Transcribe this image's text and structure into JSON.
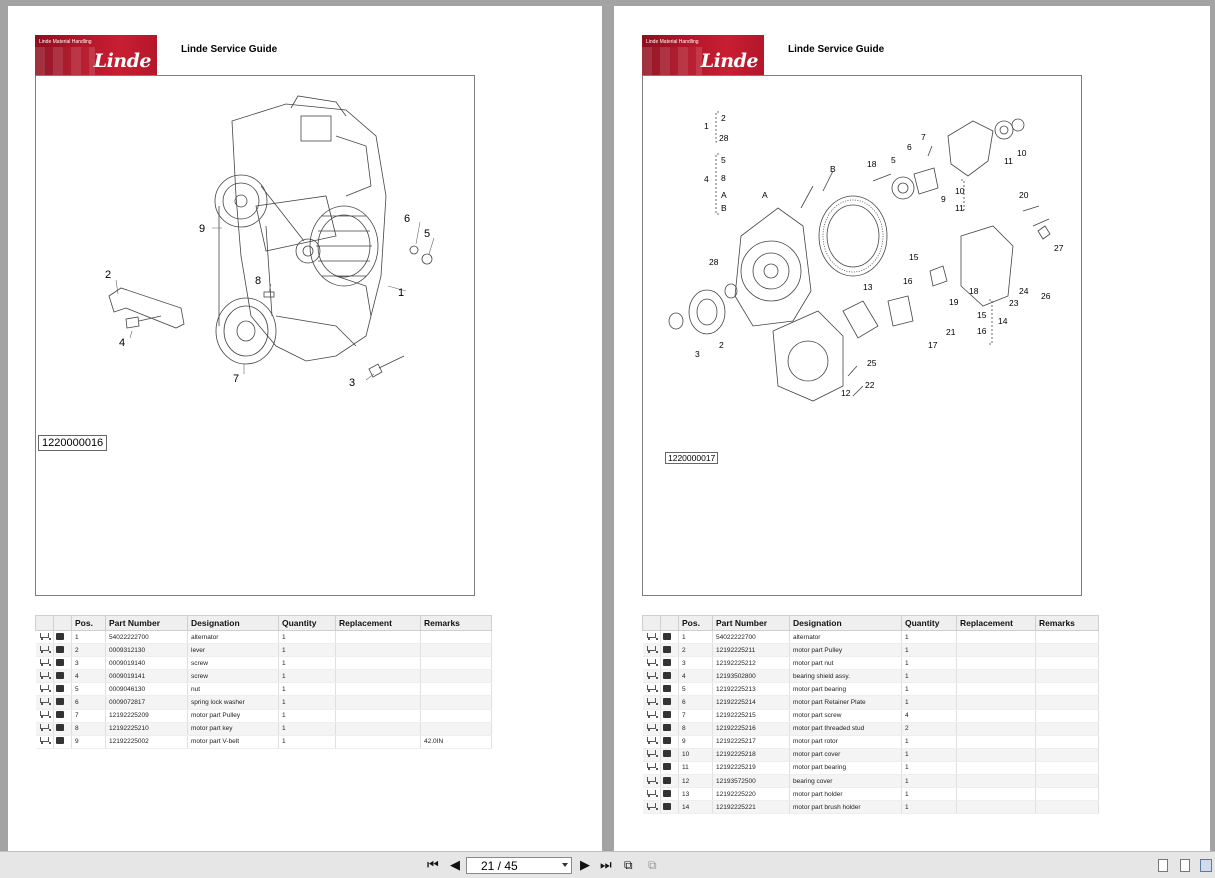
{
  "left_page": {
    "logo": {
      "small_text": "Linde Material Handling",
      "brand": "Linde"
    },
    "guide_title": "Linde Service Guide",
    "figure_id": "1220000016",
    "callouts": [
      "1",
      "2",
      "3",
      "4",
      "5",
      "6",
      "7",
      "8",
      "9"
    ],
    "table": {
      "headers": [
        "Pos.",
        "Part Number",
        "Designation",
        "Quantity",
        "Replacement",
        "Remarks"
      ],
      "rows": [
        [
          "1",
          "54022222700",
          "alternator",
          "1",
          "",
          ""
        ],
        [
          "2",
          "0009312130",
          "lever",
          "1",
          "",
          ""
        ],
        [
          "3",
          "0009019140",
          "screw",
          "1",
          "",
          ""
        ],
        [
          "4",
          "0009019141",
          "screw",
          "1",
          "",
          ""
        ],
        [
          "5",
          "0009046130",
          "nut",
          "1",
          "",
          ""
        ],
        [
          "6",
          "0009072817",
          "spring lock washer",
          "1",
          "",
          ""
        ],
        [
          "7",
          "12192225209",
          "motor part Pulley",
          "1",
          "",
          ""
        ],
        [
          "8",
          "12192225210",
          "motor part key",
          "1",
          "",
          ""
        ],
        [
          "9",
          "12192225002",
          "motor part V-belt",
          "1",
          "",
          "42.0IN"
        ]
      ]
    }
  },
  "right_page": {
    "logo": {
      "small_text": "Linde Material Handling",
      "brand": "Linde"
    },
    "guide_title": "Linde Service Guide",
    "figure_id": "1220000017",
    "callouts": [
      "1",
      "2",
      "28",
      "4",
      "5",
      "8",
      "A",
      "B",
      "A",
      "B",
      "18",
      "7",
      "6",
      "5",
      "10",
      "11",
      "9",
      "10",
      "11",
      "20",
      "27",
      "15",
      "16",
      "18",
      "19",
      "15",
      "14",
      "16",
      "13",
      "21",
      "17",
      "25",
      "22",
      "12",
      "24",
      "26",
      "23",
      "28",
      "3",
      "2"
    ],
    "table": {
      "headers": [
        "Pos.",
        "Part Number",
        "Designation",
        "Quantity",
        "Replacement",
        "Remarks"
      ],
      "rows": [
        [
          "1",
          "54022222700",
          "alternator",
          "1",
          "",
          ""
        ],
        [
          "2",
          "12192225211",
          "motor part Pulley",
          "1",
          "",
          ""
        ],
        [
          "3",
          "12192225212",
          "motor part nut",
          "1",
          "",
          ""
        ],
        [
          "4",
          "12193502800",
          "bearing shield assy.",
          "1",
          "",
          ""
        ],
        [
          "5",
          "12192225213",
          "motor part bearing",
          "1",
          "",
          ""
        ],
        [
          "6",
          "12192225214",
          "motor part Retainer Plate",
          "1",
          "",
          ""
        ],
        [
          "7",
          "12192225215",
          "motor part screw",
          "4",
          "",
          ""
        ],
        [
          "8",
          "12192225216",
          "motor part threaded stud",
          "2",
          "",
          ""
        ],
        [
          "9",
          "12192225217",
          "motor part rotor",
          "1",
          "",
          ""
        ],
        [
          "10",
          "12192225218",
          "motor part cover",
          "1",
          "",
          ""
        ],
        [
          "11",
          "12192225219",
          "motor part bearing",
          "1",
          "",
          ""
        ],
        [
          "12",
          "12193572500",
          "bearing cover",
          "1",
          "",
          ""
        ],
        [
          "13",
          "12192225220",
          "motor part holder",
          "1",
          "",
          ""
        ],
        [
          "14",
          "12192225221",
          "motor part brush holder",
          "1",
          "",
          ""
        ]
      ]
    }
  },
  "toolbar": {
    "first_icon": "first-page-icon",
    "prev_icon": "prev-page-icon",
    "page_indicator": "21 / 45",
    "next_icon": "next-page-icon",
    "last_icon": "last-page-icon"
  }
}
